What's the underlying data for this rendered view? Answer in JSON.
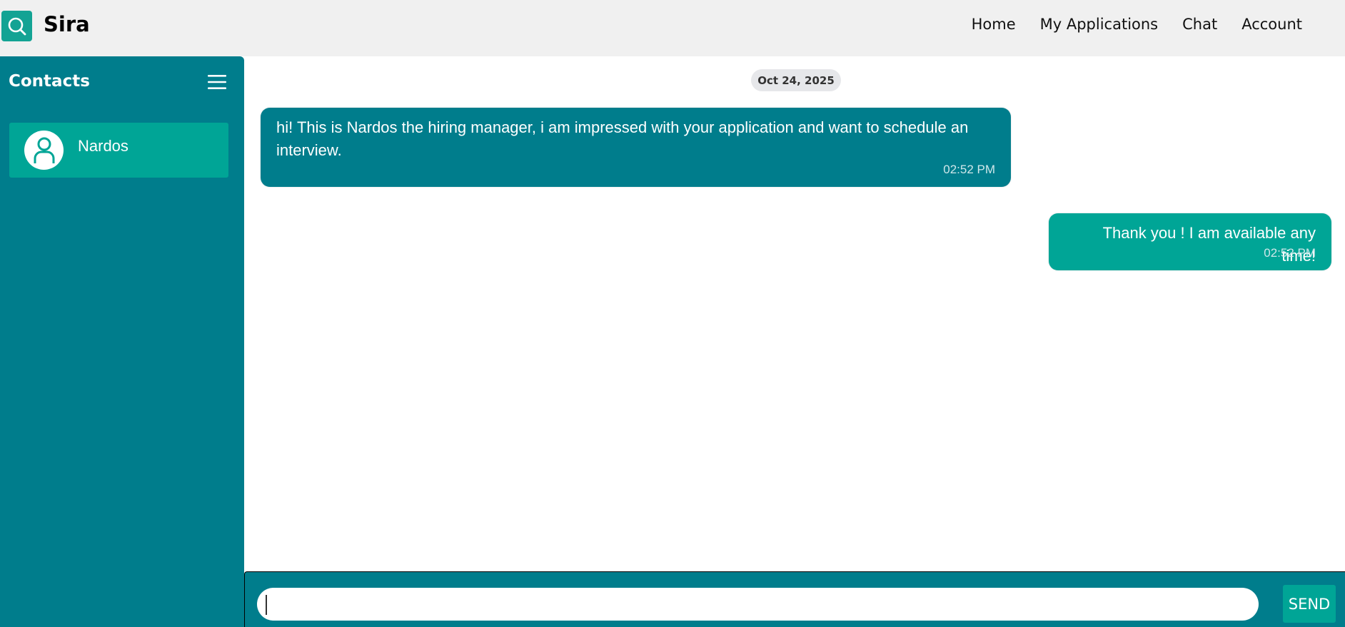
{
  "app": {
    "brand": "Sira",
    "logo_icon": "search-icon",
    "accent": "#13a394"
  },
  "nav": {
    "items": [
      "Home",
      "My Applications",
      "Chat",
      "Account"
    ]
  },
  "sidebar": {
    "title": "Contacts",
    "menu_icon": "hamburger-menu-icon",
    "contacts": [
      {
        "name": "Nardos",
        "icon": "user-avatar-icon"
      }
    ]
  },
  "chat": {
    "date": "Oct 24, 2025",
    "messages": [
      {
        "direction": "incoming",
        "text": "hi! This is Nardos the hiring manager, i am impressed with your application and want to schedule an interview.",
        "time": "02:52 PM"
      },
      {
        "direction": "outgoing",
        "text": "Thank you ! I am available any time!",
        "time": "02:52 PM"
      }
    ]
  },
  "composer": {
    "value": "",
    "send_label": "SEND"
  },
  "colors": {
    "sidebar_bg": "#007d8c",
    "contact_active_bg": "#00a596",
    "incoming_bubble": "#007d8c",
    "outgoing_bubble": "#00a596",
    "header_bg": "#f0f0f0"
  }
}
